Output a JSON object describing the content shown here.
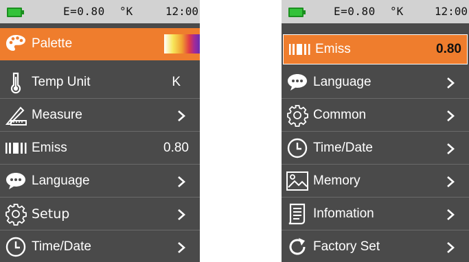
{
  "left": {
    "status": {
      "emissivity": "E=0.80",
      "unit": "°K",
      "time": "12:00"
    },
    "items": [
      {
        "label": "Palette",
        "value": "",
        "icon": "palette-icon"
      },
      {
        "label": "Temp Unit",
        "value": "K",
        "icon": "thermometer-icon"
      },
      {
        "label": "Measure",
        "value": "",
        "icon": "ruler-pencil-icon"
      },
      {
        "label": "Emiss",
        "value": "0.80",
        "icon": "emissivity-bars-icon"
      },
      {
        "label": "Language",
        "value": "",
        "icon": "speech-bubble-icon"
      },
      {
        "label": "Setup",
        "value": "",
        "icon": "gear-icon"
      },
      {
        "label": "Time/Date",
        "value": "",
        "icon": "clock-icon"
      }
    ]
  },
  "right": {
    "status": {
      "emissivity": "E=0.80",
      "unit": "°K",
      "time": "12:00"
    },
    "items": [
      {
        "label": "Emiss",
        "value": "0.80",
        "icon": "emissivity-bars-icon"
      },
      {
        "label": "Language",
        "value": "",
        "icon": "speech-bubble-icon"
      },
      {
        "label": "Common",
        "value": "",
        "icon": "gear-icon"
      },
      {
        "label": "Time/Date",
        "value": "",
        "icon": "clock-icon"
      },
      {
        "label": "Memory",
        "value": "",
        "icon": "image-icon"
      },
      {
        "label": "Infomation",
        "value": "",
        "icon": "document-icon"
      },
      {
        "label": "Factory Set",
        "value": "",
        "icon": "reset-arrow-icon"
      }
    ]
  },
  "colors": {
    "accent": "#ef7d2d",
    "menu_bg": "#4a4a4a",
    "status_bg": "#d2d2d2",
    "battery": "#34c23a"
  }
}
